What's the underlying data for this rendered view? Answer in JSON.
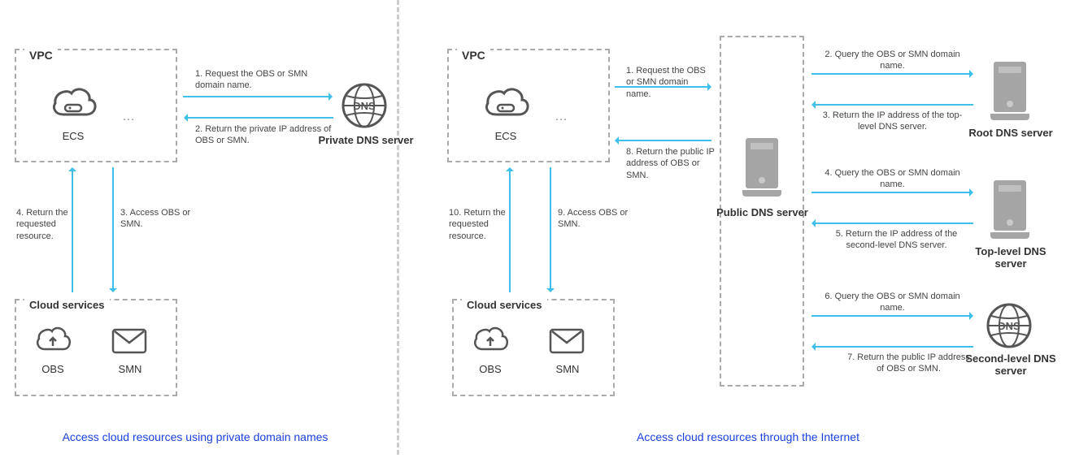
{
  "left": {
    "vpc_title": "VPC",
    "ecs_label": "ECS",
    "cloud_title": "Cloud services",
    "obs_label": "OBS",
    "smn_label": "SMN",
    "dns_label": "Private DNS server",
    "step1": "1. Request the OBS or SMN domain name.",
    "step2": "2. Return the private IP address of OBS or SMN.",
    "step3": "3. Access OBS or SMN.",
    "step4": "4. Return the requested resource.",
    "caption": "Access cloud resources using private domain names"
  },
  "right": {
    "vpc_title": "VPC",
    "ecs_label": "ECS",
    "cloud_title": "Cloud services",
    "obs_label": "OBS",
    "smn_label": "SMN",
    "public_dns_label": "Public DNS server",
    "root_dns_label": "Root DNS server",
    "tld_dns_label": "Top-level DNS server",
    "sld_dns_label": "Second-level DNS server",
    "step1": "1. Request the OBS or SMN domain name.",
    "step2": "2. Query the OBS or SMN domain name.",
    "step3": "3. Return the IP address of the top-level DNS server.",
    "step4": "4. Query the OBS or SMN domain name.",
    "step5": "5. Return the IP address of the second-level DNS server.",
    "step6": "6. Query the OBS or SMN domain name.",
    "step7": "7. Return the public IP address of OBS or SMN.",
    "step8": "8. Return the public IP address of OBS or SMN.",
    "step9": "9. Access OBS or SMN.",
    "step10": "10. Return the requested resource.",
    "caption": "Access cloud resources through the Internet"
  }
}
